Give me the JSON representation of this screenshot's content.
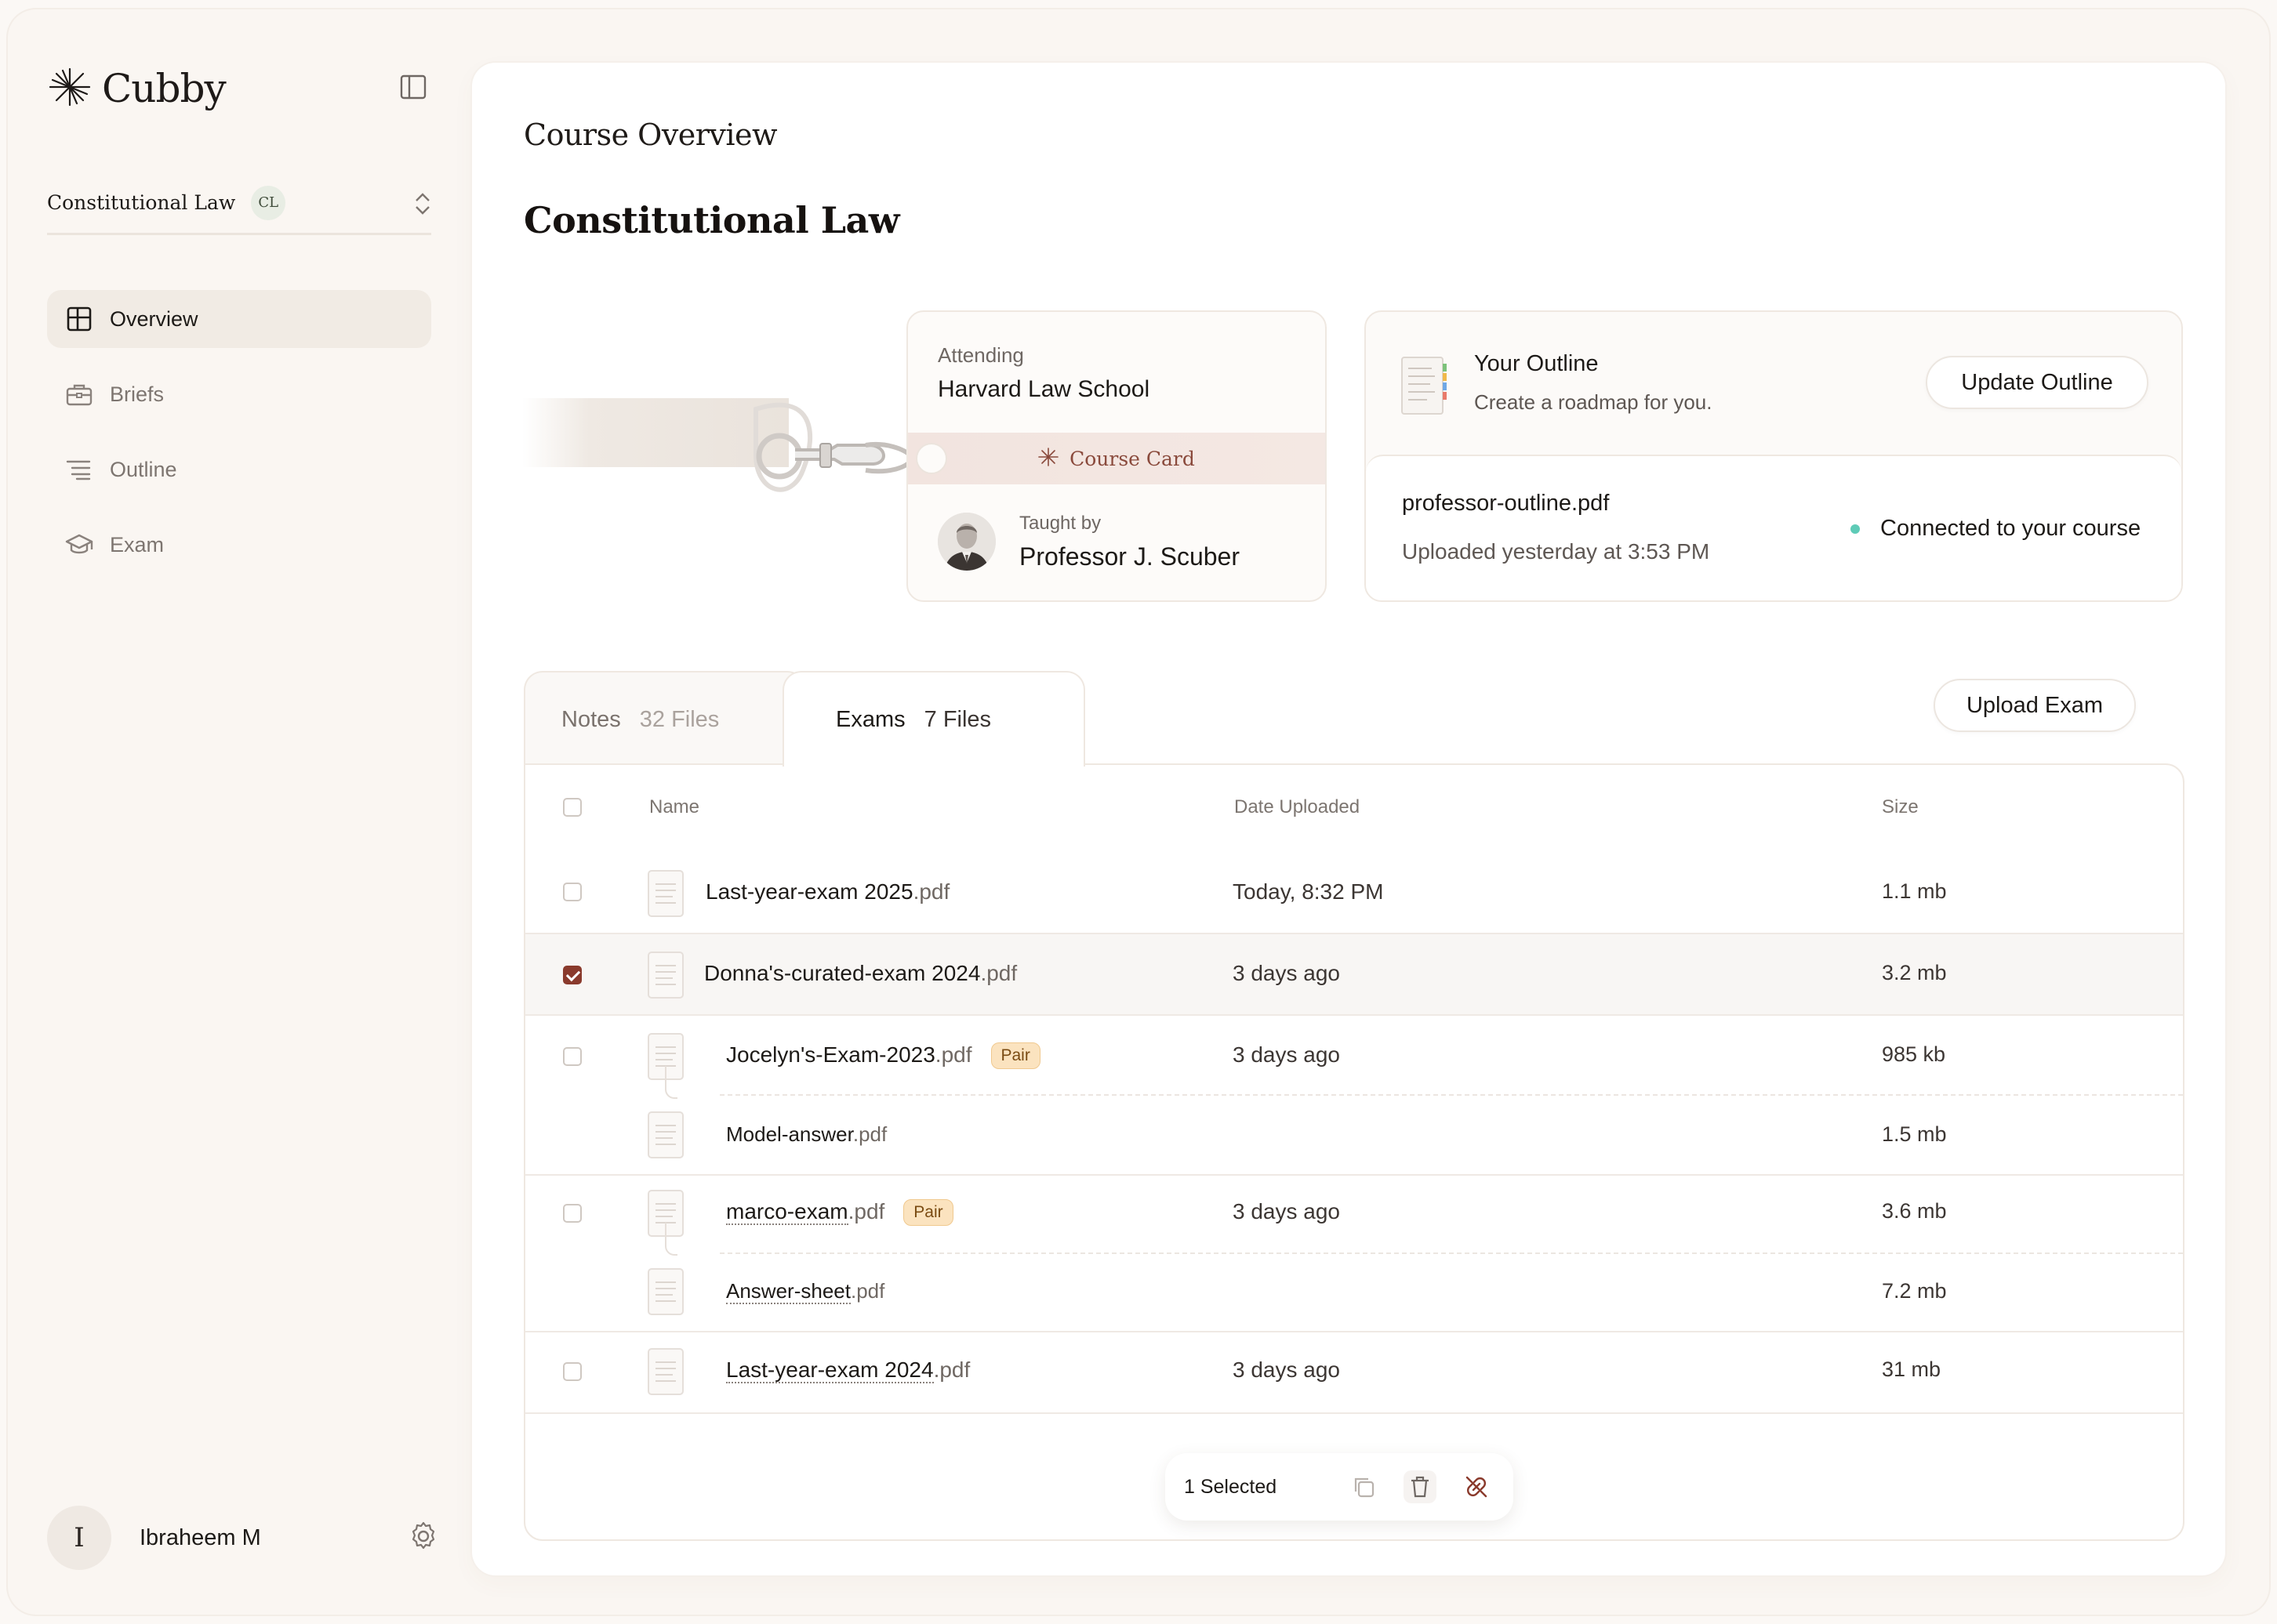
{
  "app": {
    "name": "Cubby"
  },
  "sidebar": {
    "course": {
      "name": "Constitutional Law",
      "badge": "CL"
    },
    "nav": [
      {
        "label": "Overview",
        "icon": "layout-icon",
        "active": true
      },
      {
        "label": "Briefs",
        "icon": "briefcase-icon",
        "active": false
      },
      {
        "label": "Outline",
        "icon": "list-icon",
        "active": false
      },
      {
        "label": "Exam",
        "icon": "graduation-cap-icon",
        "active": false
      }
    ],
    "user": {
      "initial": "I",
      "name": "Ibraheem M"
    }
  },
  "main": {
    "breadcrumb": "Course Overview",
    "title": "Constitutional Law",
    "course_card": {
      "attending_label": "Attending",
      "school": "Harvard Law School",
      "strip_label": "Course Card",
      "taught_label": "Taught by",
      "professor": "Professor J. Scuber"
    },
    "outline": {
      "title": "Your Outline",
      "subtitle": "Create a roadmap for you.",
      "update_button": "Update Outline",
      "file_name": "professor-outline.pdf",
      "file_uploaded": "Uploaded yesterday at 3:53 PM",
      "status": "Connected to your course",
      "status_color": "#5ecbb7"
    },
    "tabs": [
      {
        "label": "Notes",
        "count": "32 Files",
        "active": false
      },
      {
        "label": "Exams",
        "count": "7 Files",
        "active": true
      }
    ],
    "upload_button": "Upload Exam",
    "table": {
      "headers": {
        "name": "Name",
        "date": "Date Uploaded",
        "size": "Size"
      },
      "rows": [
        {
          "base": "Last-year-exam 2025",
          "ext": ".pdf",
          "date": "Today, 8:32 PM",
          "size": "1.1 mb",
          "checked": false
        },
        {
          "base": "Donna's-curated-exam 2024",
          "ext": ".pdf",
          "date": "3 days ago",
          "size": "3.2 mb",
          "checked": true
        },
        {
          "base": "Jocelyn's-Exam-2023",
          "ext": ".pdf",
          "badge": "Pair",
          "date": "3 days ago",
          "size": "985 kb",
          "checked": false
        },
        {
          "base": "Model-answer",
          "ext": ".pdf",
          "size": "1.5 mb",
          "child": true
        },
        {
          "base": "marco-exam",
          "ext": ".pdf",
          "badge": "Pair",
          "date": "3 days ago",
          "size": "3.6 mb",
          "checked": false
        },
        {
          "base": "Answer-sheet",
          "ext": ".pdf",
          "size": "7.2 mb",
          "child": true
        },
        {
          "base": "Last-year-exam 2024",
          "ext": ".pdf",
          "date": "3 days ago",
          "size": "31 mb",
          "checked": false
        }
      ]
    },
    "selection": {
      "label": "1 Selected",
      "actions": [
        "copy-icon",
        "trash-icon",
        "unlink-icon"
      ],
      "accent": "#8a3a2c"
    }
  }
}
